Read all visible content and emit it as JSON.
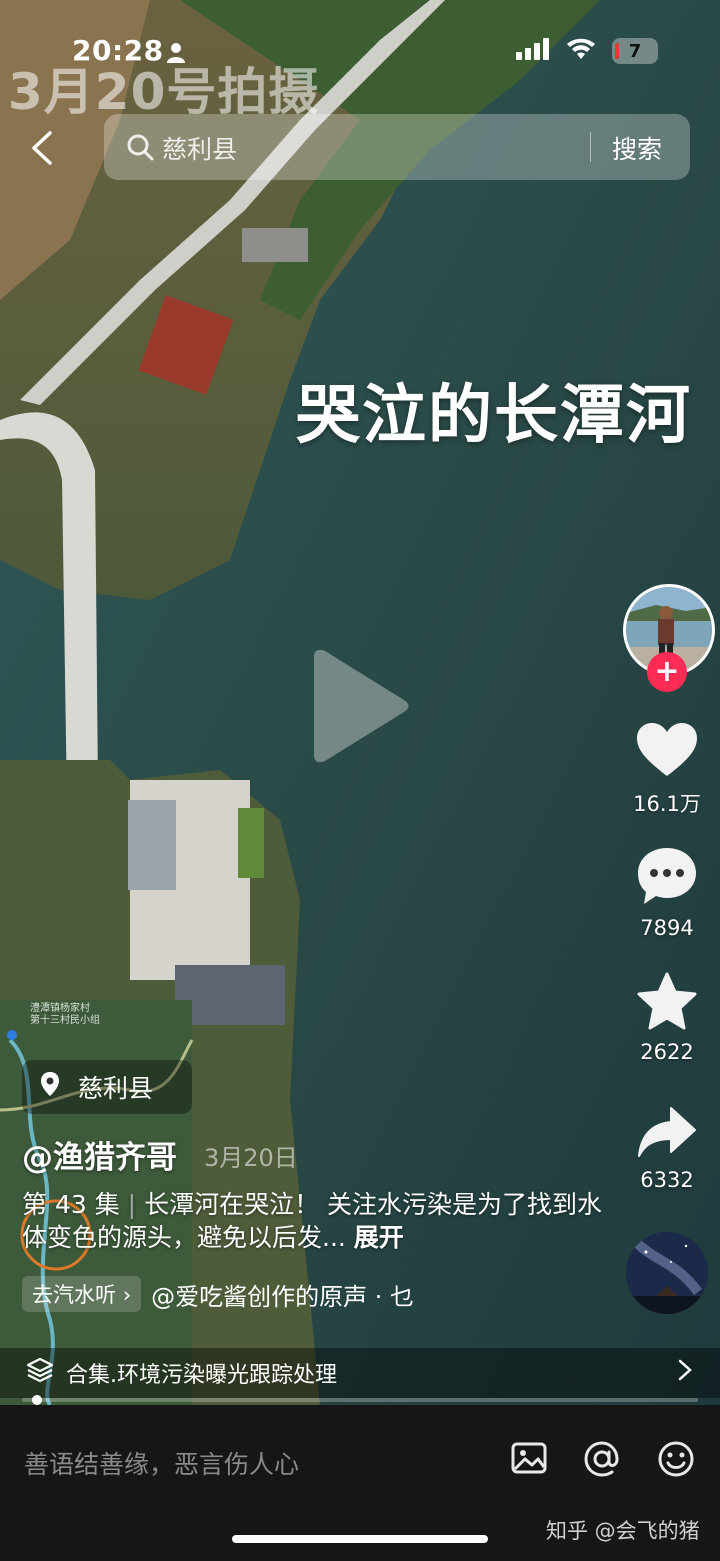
{
  "status": {
    "time": "20:28",
    "battery": "7"
  },
  "watermark_top": "3月20号拍摄",
  "search": {
    "query": "慈利县",
    "button": "搜索"
  },
  "video": {
    "caption_overlay": "哭泣的长潭河"
  },
  "actions": {
    "likes": "16.1万",
    "comments": "7894",
    "favorites": "2622",
    "shares": "6332"
  },
  "map_inset": {
    "label_line1": "澧潭镇杨家村",
    "label_line2": "第十三村民小组"
  },
  "location": {
    "name": "慈利县"
  },
  "author": {
    "handle": "@渔猎齐哥",
    "date": "3月20日"
  },
  "description": {
    "episode": "第 43 集",
    "separator": "|",
    "text": "长潭河在哭泣！ 关注水污染是为了找到水体变色的源头，避免以后发...",
    "expand": "展开"
  },
  "music": {
    "tag": "去汽水听",
    "tag_arrow": "›",
    "title": "@爱吃酱创作的原声 · 乜"
  },
  "collection": {
    "label": "合集.环境污染曝光跟踪处理"
  },
  "comment_bar": {
    "placeholder": "善语结善缘，恶言伤人心"
  },
  "credit": "知乎 @会飞的猪",
  "icons": [
    "search-icon",
    "back-icon",
    "play-icon",
    "heart-icon",
    "comment-icon",
    "star-icon",
    "share-icon",
    "location-pin-icon",
    "layers-icon",
    "chevron-right-icon",
    "image-icon",
    "at-icon",
    "emoji-icon",
    "signal-icon",
    "wifi-icon"
  ]
}
